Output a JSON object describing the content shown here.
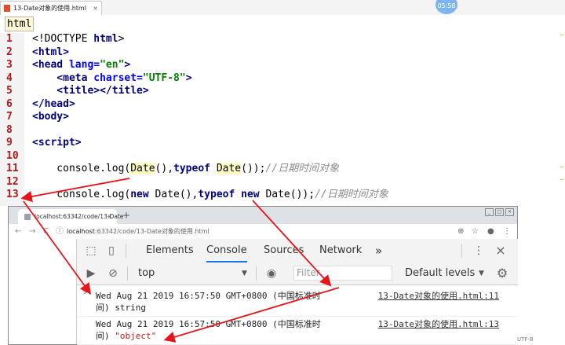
{
  "editor": {
    "tab_label": "13-Date对象的使用.html",
    "tab_close": "×",
    "timer": "05:58",
    "breadcrumb": "html",
    "line_numbers": [
      "1",
      "2",
      "3",
      "4",
      "5",
      "6",
      "7",
      "8",
      "9",
      "10",
      "11",
      "12",
      "13"
    ],
    "lines": {
      "l1_a": "<!DOCTYPE ",
      "l1_b": "html",
      "l1_c": ">",
      "l2": "<html>",
      "l3_a": "<head ",
      "l3_b": "lang=",
      "l3_c": "\"en\"",
      "l3_d": ">",
      "l4_a": "    <meta ",
      "l4_b": "charset=",
      "l4_c": "\"UTF-8\"",
      "l4_d": ">",
      "l5": "    <title></title>",
      "l6": "</head>",
      "l7": "<body>",
      "l9": "<script>",
      "l11_a": "    console.",
      "l11_b": "log(",
      "l11_c": "Date",
      "l11_d": "(),",
      "l11_e": "typeof ",
      "l11_f": "Date",
      "l11_g": "());",
      "l11_h": "//日期时间对象",
      "l13_a": "    console.",
      "l13_b": "log(",
      "l13_c": "new ",
      "l13_d": "Date(),",
      "l13_e": "typeof ",
      "l13_f": "new ",
      "l13_g": "Date());",
      "l13_h": "//日期时间对象"
    }
  },
  "browser": {
    "tab_label": "localhost:63342/code/13-Date",
    "tab_close": "×",
    "new_tab": "+",
    "url_host": "localhost",
    "url_path": ":63342/code/13-Date对象的使用.html",
    "nav_back": "←",
    "nav_forward": "→",
    "nav_reload": "C",
    "info_icon": "ⓘ"
  },
  "devtools": {
    "tabs": [
      "Elements",
      "Console",
      "Sources",
      "Network"
    ],
    "active_tab": "Console",
    "more_tabs": "»",
    "menu": "⋮",
    "close": "×",
    "context": "top",
    "filter_placeholder": "Filter",
    "levels": "Default levels",
    "messages": [
      {
        "text_line1": "Wed Aug 21 2019 16:57:50 GMT+0800 (中国标准时",
        "text_line2_a": "间) ",
        "text_line2_b": "string",
        "source": "13-Date对象的使用.html:11"
      },
      {
        "text_line1": "Wed Aug 21 2019 16:57:50 GMT+0800 (中国标准时",
        "text_line2_a": "间) ",
        "text_line2_b": "\"object\"",
        "source": "13-Date对象的使用.html:13"
      }
    ]
  },
  "status": {
    "encoding": "UTF-8"
  },
  "colors": {
    "annotation_arrow": "#e8141a",
    "active_tab_underline": "#1a73e8",
    "line_number": "#b01a1a"
  }
}
